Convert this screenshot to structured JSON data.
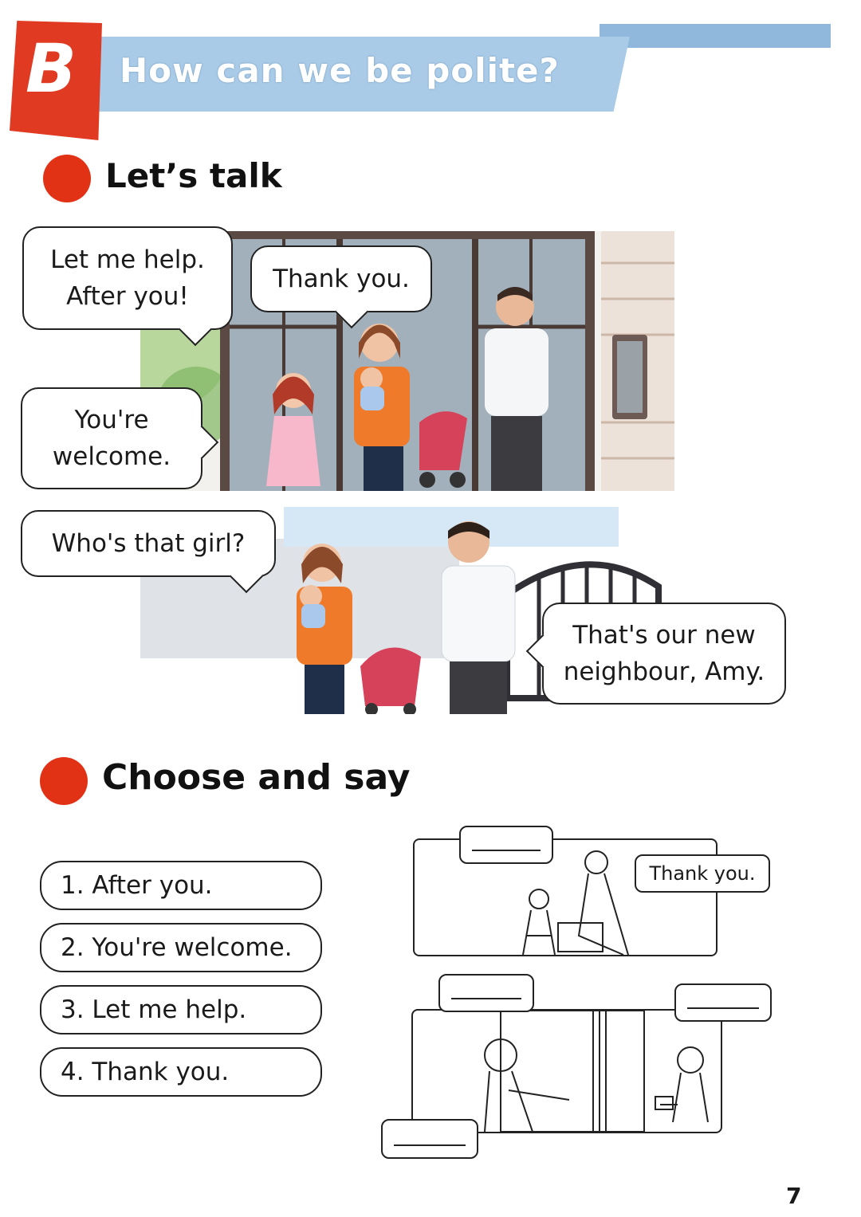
{
  "header": {
    "badge_letter": "B",
    "title": "How can we be polite?"
  },
  "lets_talk": {
    "heading": "Let’s talk",
    "scene1_bubbles": {
      "girl": [
        "Let me help.",
        "After you!"
      ],
      "mother": "Thank you.",
      "man": [
        "You're",
        "welcome."
      ]
    },
    "scene2_bubbles": {
      "mother": "Who's that girl?",
      "father": [
        "That's our new",
        "neighbour, Amy."
      ]
    }
  },
  "choose_and_say": {
    "heading": "Choose and say",
    "options": [
      "1. After you.",
      "2. You're welcome.",
      "3. Let me help.",
      "4. Thank you."
    ],
    "worksheet_bubble": "Thank you."
  },
  "page_number": "7",
  "colors": {
    "accent_red": "#e23216",
    "banner_blue": "#a9cbe8"
  }
}
